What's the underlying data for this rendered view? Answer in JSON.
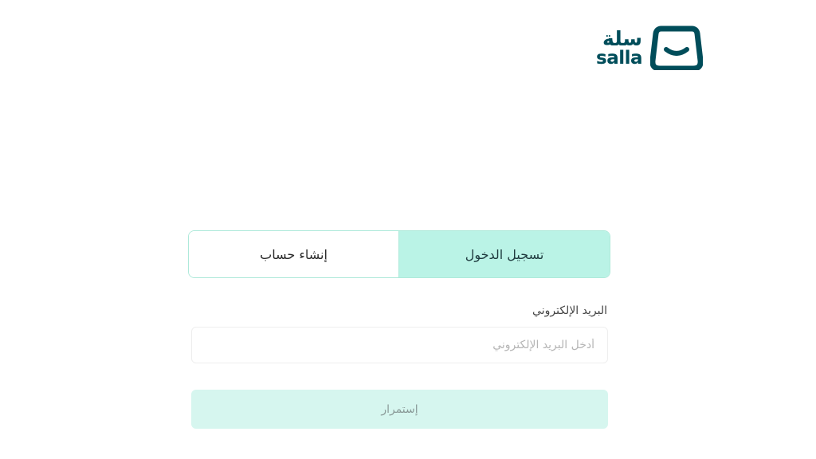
{
  "brand": {
    "name_ar": "سلة",
    "name_en": "salla",
    "color": "#004d5a",
    "icon": "salla-bag-icon"
  },
  "tabs": [
    {
      "label": "تسجيل الدخول",
      "active": true
    },
    {
      "label": "إنشاء حساب",
      "active": false
    }
  ],
  "form": {
    "email_label": "البريد الإلكتروني",
    "email_value": "",
    "email_placeholder": "أدخل البريد الإلكتروني",
    "continue_label": "إستمرار"
  },
  "colors": {
    "accent": "#baf3e6",
    "accent_border": "#aee9da",
    "button_bg": "#d6f6ef"
  }
}
